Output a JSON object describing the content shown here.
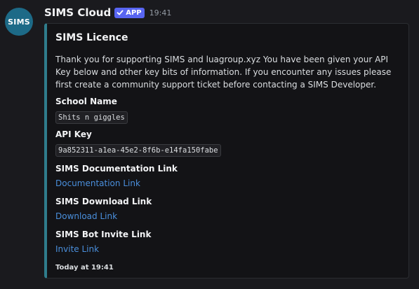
{
  "message": {
    "avatar_text": "SIMS",
    "author": "SIMS Cloud",
    "badge_label": "APP",
    "timestamp": "19:41"
  },
  "embed": {
    "accent_color": "#2f7d8c",
    "title": "SIMS Licence",
    "description": "Thank you for supporting SIMS and luagroup.xyz You have been given your API Key below and other key bits of information. If you encounter any issues please first create a community support ticket before contacting a SIMS Developer.",
    "fields": [
      {
        "name": "School Name",
        "value": "Shits n giggles"
      },
      {
        "name": "API Key",
        "value": "9a852311-a1ea-45e2-8f6b-e14fa150fabe"
      },
      {
        "name": "SIMS Documentation Link",
        "value": "Documentation Link"
      },
      {
        "name": "SIMS Download Link",
        "value": "Download Link"
      },
      {
        "name": "SIMS Bot Invite Link",
        "value": "Invite Link"
      }
    ],
    "footer": "Today at 19:41"
  },
  "colors": {
    "background": "#1a1a1e",
    "badge": "#5865f2",
    "link": "#4a8fdc"
  },
  "icons": {
    "avatar": "sims-logo-avatar",
    "badge_check": "checkmark-icon"
  }
}
